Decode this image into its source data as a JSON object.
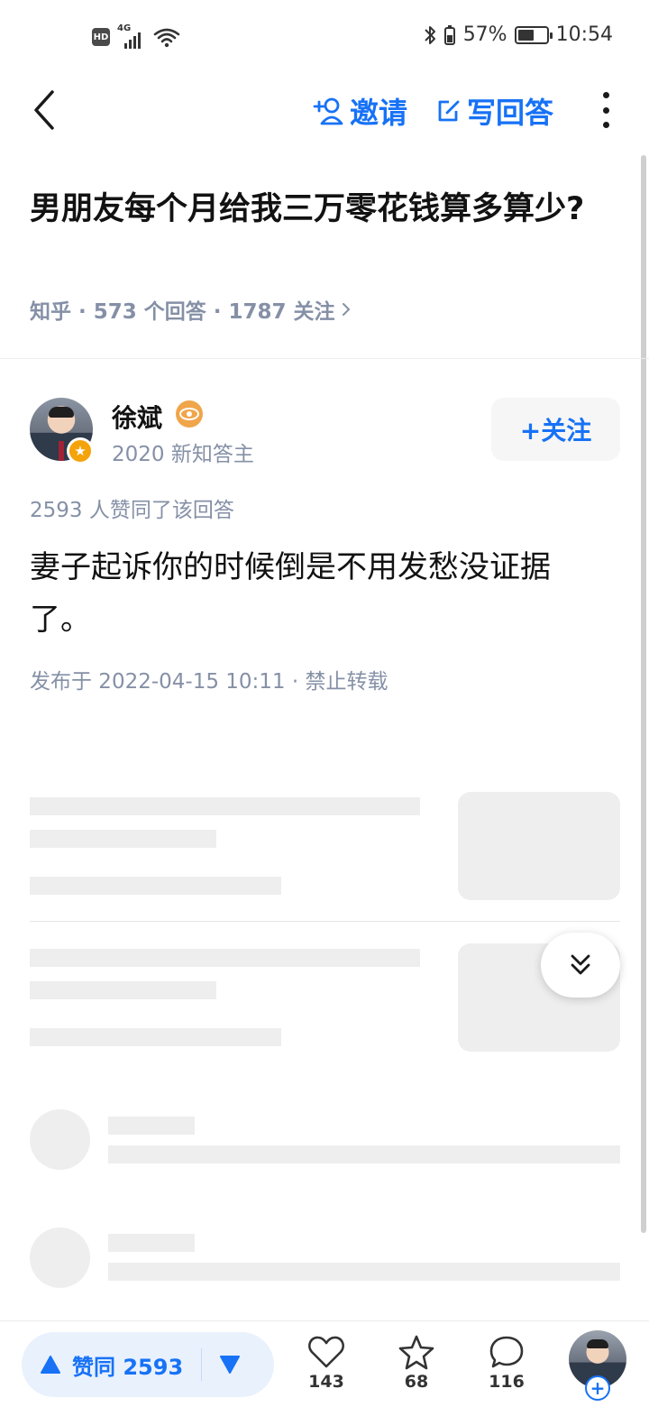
{
  "status_bar": {
    "hd": "HD",
    "network": "4G",
    "battery_percent": "57%",
    "battery_level": 0.57,
    "time": "10:54"
  },
  "nav": {
    "invite_label": "邀请",
    "write_label": "写回答"
  },
  "question": {
    "title": "男朋友每个月给我三万零花钱算多算少?",
    "meta": "知乎 · 573 个回答 · 1787 关注"
  },
  "answer": {
    "author_name": "徐斌",
    "author_title": "2020 新知答主",
    "follow_label": "+关注",
    "upvote_summary": "2593 人赞同了该回答",
    "content": "妻子起诉你的时候倒是不用发愁没证据了。",
    "publish_info": "发布于 2022-04-15 10:11 · 禁止转载"
  },
  "bottom_bar": {
    "upvote_label": "赞同 2593",
    "like_count": "143",
    "favorite_count": "68",
    "comment_count": "116"
  },
  "colors": {
    "accent": "#1772f6",
    "muted_text": "#8590a6",
    "skeleton": "#eeeeee"
  },
  "icons": [
    "back-arrow-icon",
    "add-person-icon",
    "edit-icon",
    "more-dots-icon",
    "chevron-right-icon",
    "eye-badge-icon",
    "star-badge-icon",
    "double-chevron-down-icon",
    "triangle-up-icon",
    "triangle-down-icon",
    "heart-icon",
    "star-icon",
    "comment-icon",
    "plus-icon"
  ]
}
